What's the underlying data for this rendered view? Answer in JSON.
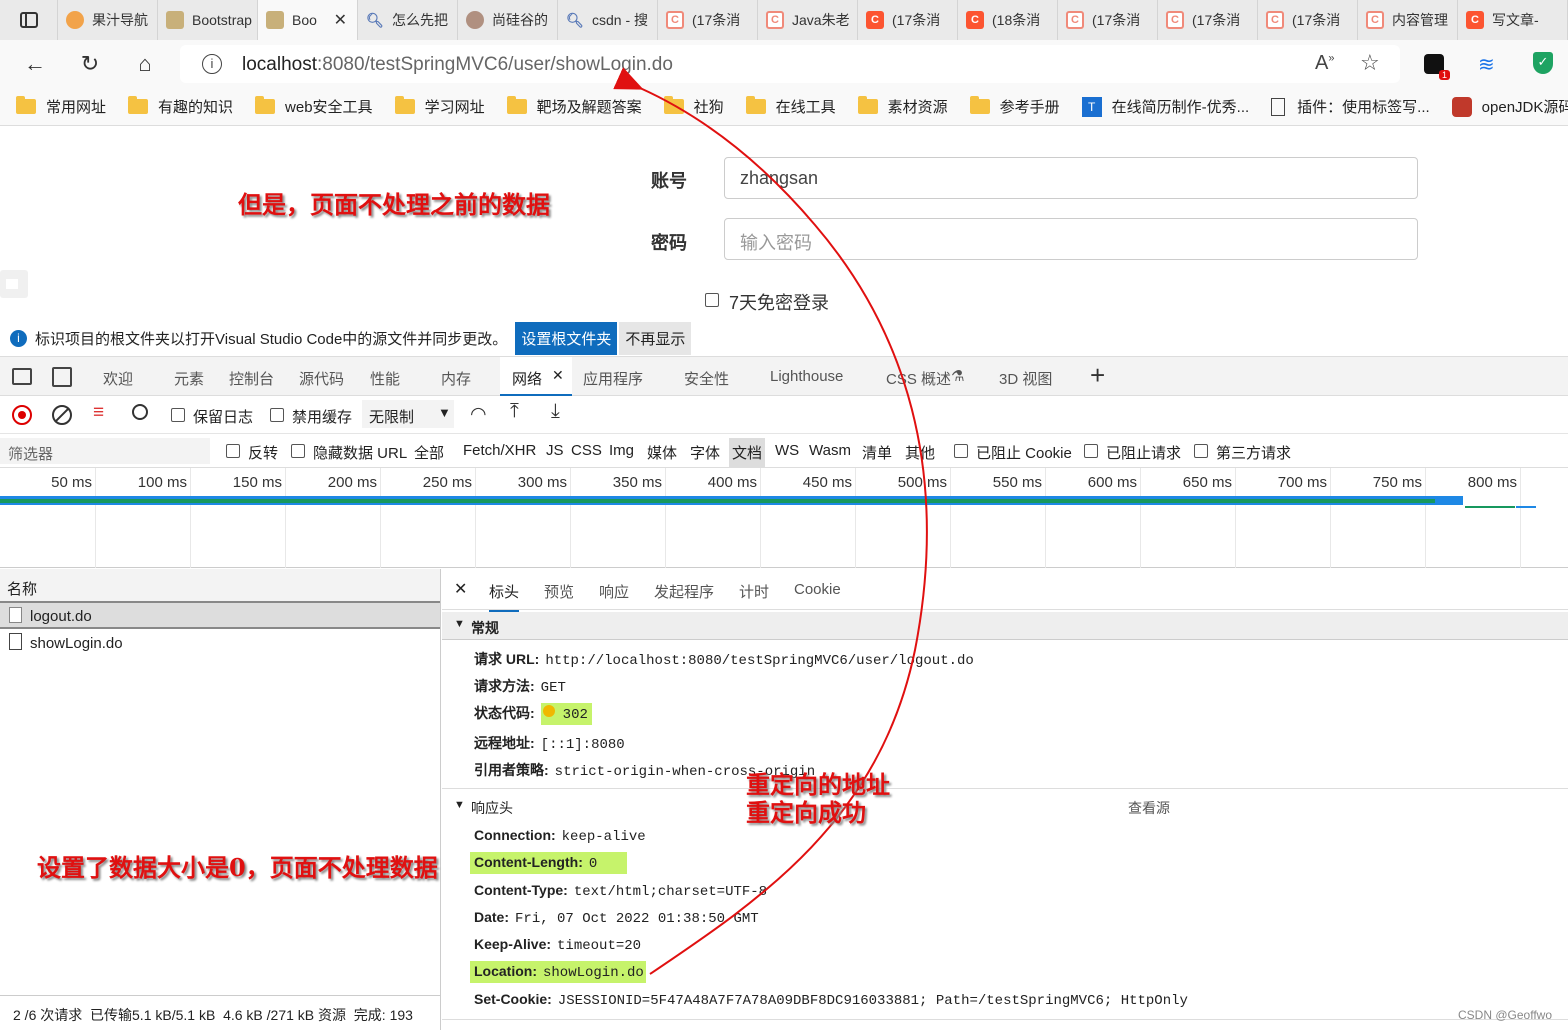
{
  "tabs": [
    {
      "label": "",
      "icon": "tab-actions-icon"
    },
    {
      "label": "果汁导航",
      "icon": "guo-icon"
    },
    {
      "label": "Bootstrap",
      "icon": "bootstrap-icon"
    },
    {
      "label": "Boo",
      "icon": "bootstrap-icon",
      "active": true
    },
    {
      "label": "怎么先把",
      "icon": "search-icon"
    },
    {
      "label": "尚硅谷的",
      "icon": "avatar-icon"
    },
    {
      "label": "csdn - 搜",
      "icon": "search-icon"
    },
    {
      "label": "(17条消",
      "icon": "csdn-icon"
    },
    {
      "label": "Java朱老",
      "icon": "csdn-icon"
    },
    {
      "label": "(17条消",
      "icon": "csdn-icon"
    },
    {
      "label": "(18条消",
      "icon": "csdn-icon"
    },
    {
      "label": "(17条消",
      "icon": "csdn-icon"
    },
    {
      "label": "(17条消",
      "icon": "csdn-icon"
    },
    {
      "label": "(17条消",
      "icon": "csdn-icon"
    },
    {
      "label": "内容管理",
      "icon": "csdn-icon"
    },
    {
      "label": "写文章-",
      "icon": "csdn-icon"
    }
  ],
  "address": {
    "host": "localhost",
    "path": ":8080/testSpringMVC6/user/showLogin.do"
  },
  "bookmarks": [
    "常用网址",
    "有趣的知识",
    "web安全工具",
    "学习网址",
    "靶场及解题答案",
    "社狗",
    "在线工具",
    "素材资源",
    "参考手册",
    "在线简历制作-优秀...",
    "插件：使用标签写...",
    "openJDK源码下"
  ],
  "page": {
    "account_label": "账号",
    "account_value": "zhangsan",
    "password_label": "密码",
    "password_placeholder": "输入密码",
    "remember_label": "7天免密登录"
  },
  "infobar": {
    "text": "标识项目的根文件夹以打开Visual Studio Code中的源文件并同步更改。",
    "set_root": "设置根文件夹",
    "dismiss": "不再显示"
  },
  "devtools_tabs": [
    "欢迎",
    "元素",
    "控制台",
    "源代码",
    "性能",
    "内存",
    "网络",
    "应用程序",
    "安全性",
    "Lighthouse",
    "CSS 概述",
    "3D 视图"
  ],
  "toolbar": {
    "preserve_log": "保留日志",
    "disable_cache": "禁用缓存",
    "throttle": "无限制"
  },
  "filter": {
    "placeholder": "筛选器",
    "invert": "反转",
    "hide_data_url": "隐藏数据 URL",
    "types": [
      "全部",
      "Fetch/XHR",
      "JS",
      "CSS",
      "Img",
      "媒体",
      "字体",
      "文档",
      "WS",
      "Wasm",
      "清单",
      "其他"
    ],
    "blocked_cookies": "已阻止 Cookie",
    "blocked_requests": "已阻止请求",
    "third_party": "第三方请求"
  },
  "timeline_ticks": [
    "50 ms",
    "100 ms",
    "150 ms",
    "200 ms",
    "250 ms",
    "300 ms",
    "350 ms",
    "400 ms",
    "450 ms",
    "500 ms",
    "550 ms",
    "600 ms",
    "650 ms",
    "700 ms",
    "750 ms",
    "800 ms"
  ],
  "requests": {
    "header": "名称",
    "items": [
      "logout.do",
      "showLogin.do"
    ],
    "status": "2 /6 次请求  已传输5.1 kB/5.1 kB  4.6 kB /271 kB 资源  完成: 193"
  },
  "detail_tabs": [
    "标头",
    "预览",
    "响应",
    "发起程序",
    "计时",
    "Cookie"
  ],
  "general": {
    "title": "常规",
    "rows": [
      {
        "k": "请求 URL:",
        "v": "http://localhost:8080/testSpringMVC6/user/logout.do"
      },
      {
        "k": "请求方法:",
        "v": "GET"
      },
      {
        "k": "状态代码:",
        "v": "302"
      },
      {
        "k": "远程地址:",
        "v": "[::1]:8080"
      },
      {
        "k": "引用者策略:",
        "v": "strict-origin-when-cross-origin"
      }
    ]
  },
  "response_headers": {
    "title": "响应头",
    "view_source": "查看源",
    "rows": [
      {
        "k": "Connection:",
        "v": "keep-alive"
      },
      {
        "k": "Content-Length:",
        "v": "0"
      },
      {
        "k": "Content-Type:",
        "v": "text/html;charset=UTF-8"
      },
      {
        "k": "Date:",
        "v": "Fri, 07 Oct 2022 01:38:50 GMT"
      },
      {
        "k": "Keep-Alive:",
        "v": "timeout=20"
      },
      {
        "k": "Location:",
        "v": "showLogin.do"
      },
      {
        "k": "Set-Cookie:",
        "v": "JSESSIONID=5F47A48A7F7A78A09DBF8DC916033881; Path=/testSpringMVC6; HttpOnly"
      }
    ]
  },
  "annotations": {
    "note1": "但是，页面不处理之前的数据",
    "note2a": "重定向的地址",
    "note2b": "重定向成功",
    "note3": "设置了数据大小是0，页面不处理数据"
  },
  "watermark": "CSDN @Geoffwo"
}
